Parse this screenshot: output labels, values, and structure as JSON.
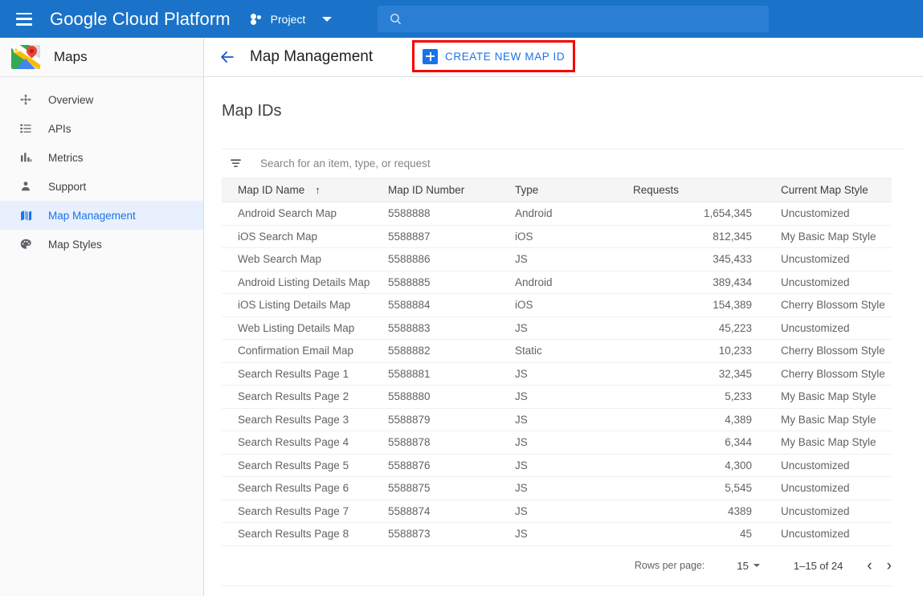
{
  "topbar": {
    "menu_icon": "hamburger-icon",
    "brand_bold": "Google",
    "brand_light": "Cloud Platform",
    "project_label": "Project",
    "project_icon": "project-dots-icon",
    "dropdown_icon": "chevron-down-icon",
    "search_icon": "search-icon",
    "search_value": "",
    "search_placeholder": "",
    "bg_color": "#1a73c8",
    "search_bg_color": "#2a7fd4"
  },
  "sidebar": {
    "product_icon": "google-maps-logo-icon",
    "product_name": "Maps",
    "active_item": "Map Management",
    "active_bg_color": "#e8f0fe",
    "active_text_color": "#1a73e8",
    "items": [
      {
        "label": "Overview",
        "icon": "overview-move-icon"
      },
      {
        "label": "APIs",
        "icon": "list-icon"
      },
      {
        "label": "Metrics",
        "icon": "bar-chart-icon"
      },
      {
        "label": "Support",
        "icon": "person-icon"
      },
      {
        "label": "Map Management",
        "icon": "map-icon"
      },
      {
        "label": "Map Styles",
        "icon": "palette-icon"
      }
    ]
  },
  "page_header": {
    "back_icon": "back-arrow-icon",
    "title": "Map Management",
    "create_button_label": "CREATE NEW MAP ID",
    "create_button_icon": "plus-box-icon",
    "highlight_color": "#f50000",
    "accent_color": "#1a73e8"
  },
  "main": {
    "section_title": "Map IDs",
    "search": {
      "icon": "filter-list-icon",
      "value": "",
      "placeholder": "Search for an item, type, or request"
    },
    "table": {
      "columns": [
        {
          "label": "Map ID Name",
          "sort": "ascending",
          "sort_icon": "arrow-up-icon"
        },
        {
          "label": "Map ID Number"
        },
        {
          "label": "Type"
        },
        {
          "label": "Requests"
        },
        {
          "label": "Current Map Style"
        }
      ],
      "rows": [
        {
          "name": "Android Search Map",
          "number": "5588888",
          "type": "Android",
          "requests": "1,654,345",
          "style": "Uncustomized"
        },
        {
          "name": "iOS Search Map",
          "number": "5588887",
          "type": "iOS",
          "requests": "812,345",
          "style": "My Basic Map Style"
        },
        {
          "name": "Web Search Map",
          "number": "5588886",
          "type": "JS",
          "requests": "345,433",
          "style": "Uncustomized"
        },
        {
          "name": "Android Listing Details Map",
          "number": "5588885",
          "type": "Android",
          "requests": "389,434",
          "style": "Uncustomized"
        },
        {
          "name": "iOS Listing Details Map",
          "number": "5588884",
          "type": "iOS",
          "requests": "154,389",
          "style": "Cherry Blossom Style"
        },
        {
          "name": "Web Listing Details Map",
          "number": "5588883",
          "type": "JS",
          "requests": "45,223",
          "style": "Uncustomized"
        },
        {
          "name": "Confirmation Email Map",
          "number": "5588882",
          "type": "Static",
          "requests": "10,233",
          "style": "Cherry Blossom Style"
        },
        {
          "name": "Search Results Page 1",
          "number": "5588881",
          "type": "JS",
          "requests": "32,345",
          "style": "Cherry Blossom Style"
        },
        {
          "name": "Search Results Page 2",
          "number": "5588880",
          "type": "JS",
          "requests": "5,233",
          "style": "My Basic Map Style"
        },
        {
          "name": "Search Results Page 3",
          "number": "5588879",
          "type": "JS",
          "requests": "4,389",
          "style": "My Basic Map Style"
        },
        {
          "name": "Search Results Page 4",
          "number": "5588878",
          "type": "JS",
          "requests": "6,344",
          "style": "My Basic Map Style"
        },
        {
          "name": "Search Results Page 5",
          "number": "5588876",
          "type": "JS",
          "requests": "4,300",
          "style": "Uncustomized"
        },
        {
          "name": "Search Results Page 6",
          "number": "5588875",
          "type": "JS",
          "requests": "5,545",
          "style": "Uncustomized"
        },
        {
          "name": "Search Results Page 7",
          "number": "5588874",
          "type": "JS",
          "requests": "4389",
          "style": "Uncustomized"
        },
        {
          "name": "Search Results Page 8",
          "number": "5588873",
          "type": "JS",
          "requests": "45",
          "style": "Uncustomized"
        }
      ]
    },
    "pagination": {
      "rows_per_page_label": "Rows per page:",
      "rows_per_page_value": "15",
      "range_label": "1–15 of 24",
      "prev_icon": "chevron-left-icon",
      "prev_glyph": "‹",
      "next_icon": "chevron-right-icon",
      "next_glyph": "›"
    }
  }
}
